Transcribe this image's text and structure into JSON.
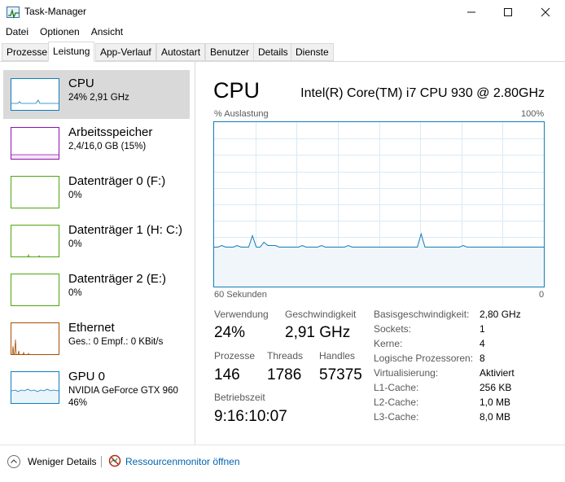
{
  "window": {
    "title": "Task-Manager"
  },
  "menu": [
    "Datei",
    "Optionen",
    "Ansicht"
  ],
  "tabs": [
    "Prozesse",
    "Leistung",
    "App-Verlauf",
    "Autostart",
    "Benutzer",
    "Details",
    "Dienste"
  ],
  "active_tab": "Leistung",
  "sidebar": [
    {
      "title": "CPU",
      "sub": "24% 2,91 GHz",
      "sub2": "",
      "color": "#117dbb"
    },
    {
      "title": "Arbeitsspeicher",
      "sub": "2,4/16,0 GB (15%)",
      "sub2": "",
      "color": "#8b12ae"
    },
    {
      "title": "Datenträger 0 (F:)",
      "sub": "0%",
      "sub2": "",
      "color": "#4da60c"
    },
    {
      "title": "Datenträger 1 (H: C:)",
      "sub": "0%",
      "sub2": "",
      "color": "#4da60c"
    },
    {
      "title": "Datenträger 2 (E:)",
      "sub": "0%",
      "sub2": "",
      "color": "#4da60c"
    },
    {
      "title": "Ethernet",
      "sub": "Ges.: 0 Empf.: 0 KBit/s",
      "sub2": "",
      "color": "#a74f01"
    },
    {
      "title": "GPU 0",
      "sub": "NVIDIA GeForce GTX 960",
      "sub2": "46%",
      "color": "#117dbb"
    }
  ],
  "main": {
    "title": "CPU",
    "cpu_name": "Intel(R) Core(TM) i7 CPU 930 @ 2.80GHz",
    "graph_label_left": "% Auslastung",
    "graph_label_right": "100%",
    "time_left": "60 Sekunden",
    "time_right": "0",
    "stats": {
      "usage_label": "Verwendung",
      "usage_value": "24%",
      "speed_label": "Geschwindigkeit",
      "speed_value": "2,91 GHz",
      "processes_label": "Prozesse",
      "processes_value": "146",
      "threads_label": "Threads",
      "threads_value": "1786",
      "handles_label": "Handles",
      "handles_value": "57375",
      "uptime_label": "Betriebszeit",
      "uptime_value": "9:16:10:07"
    },
    "details": [
      {
        "key": "Basisgeschwindigkeit:",
        "value": "2,80 GHz"
      },
      {
        "key": "Sockets:",
        "value": "1"
      },
      {
        "key": "Kerne:",
        "value": "4"
      },
      {
        "key": "Logische Prozessoren:",
        "value": "8"
      },
      {
        "key": "Virtualisierung:",
        "value": "Aktiviert"
      },
      {
        "key": "L1-Cache:",
        "value": "256 KB"
      },
      {
        "key": "L2-Cache:",
        "value": "1,0 MB"
      },
      {
        "key": "L3-Cache:",
        "value": "8,0 MB"
      }
    ],
    "cpu_history_percent": [
      24,
      24,
      25,
      24,
      24,
      24,
      25,
      24,
      24,
      24,
      31,
      24,
      24,
      27,
      25,
      25,
      25,
      24,
      24,
      24,
      24,
      24,
      24,
      25,
      24,
      24,
      24,
      24,
      25,
      24,
      24,
      24,
      24,
      24,
      24,
      25,
      24,
      24,
      24,
      24,
      24,
      24,
      24,
      24,
      24,
      24,
      24,
      24,
      24,
      24,
      24,
      24,
      24,
      24,
      32,
      24,
      24,
      24,
      24,
      24,
      24,
      24,
      24,
      24,
      24,
      25,
      24,
      24,
      24,
      24,
      24,
      24,
      24,
      24,
      24,
      24,
      24,
      24,
      24,
      24,
      24,
      24,
      24,
      24,
      24,
      24,
      24
    ]
  },
  "footer": {
    "less_details": "Weniger Details",
    "resource_monitor": "Ressourcenmonitor öffnen"
  },
  "colors": {
    "cpu": "#117dbb",
    "memory": "#8b12ae",
    "disk": "#4da60c",
    "ethernet": "#a74f01",
    "selected": "#d9d9d9"
  }
}
